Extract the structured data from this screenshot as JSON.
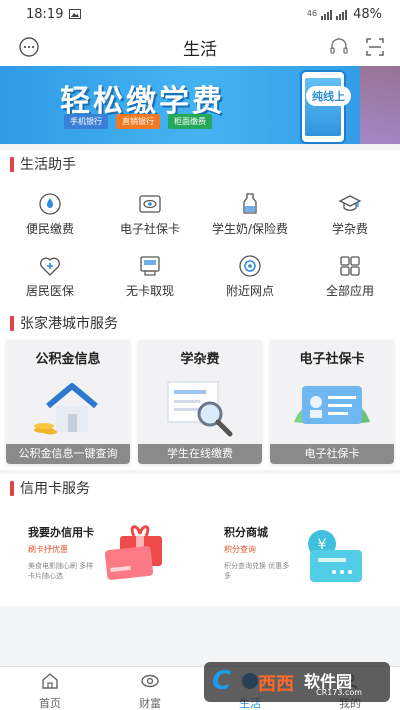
{
  "status_bar": {
    "time": "18:19",
    "signal": "46",
    "battery": "48%"
  },
  "header": {
    "title": "生活"
  },
  "banner": {
    "headline": "轻松缴学费",
    "tags": [
      "手机银行",
      "直销银行",
      "柜面缴费"
    ],
    "phone_label": "纯线上"
  },
  "life_helper": {
    "title": "生活助手",
    "items": [
      {
        "label": "便民缴费",
        "icon": "droplet-icon"
      },
      {
        "label": "电子社保卡",
        "icon": "eye-card-icon"
      },
      {
        "label": "学生奶/保险费",
        "icon": "milk-bottle-icon"
      },
      {
        "label": "学杂费",
        "icon": "graduation-cap-icon"
      },
      {
        "label": "居民医保",
        "icon": "heart-plus-icon"
      },
      {
        "label": "无卡取现",
        "icon": "atm-icon"
      },
      {
        "label": "附近网点",
        "icon": "location-pin-icon"
      },
      {
        "label": "全部应用",
        "icon": "grid-apps-icon"
      }
    ]
  },
  "city_services": {
    "title": "张家港城市服务",
    "cards": [
      {
        "title": "公积金信息",
        "caption": "公积金信息一键查询"
      },
      {
        "title": "学杂费",
        "caption": "学生在线缴费"
      },
      {
        "title": "电子社保卡",
        "caption": "电子社保卡"
      }
    ]
  },
  "credit_card": {
    "title": "信用卡服务",
    "items": [
      {
        "title": "我要办信用卡",
        "subtitle": "刷卡抒优惠",
        "desc": "美食电影随心刷 多样卡片随心选"
      },
      {
        "title": "积分商城",
        "subtitle": "积分查询",
        "desc": "积分查询兑换 优惠多多"
      }
    ]
  },
  "bottom_nav": {
    "items": [
      {
        "label": "首页",
        "icon": "home-icon"
      },
      {
        "label": "财富",
        "icon": "eye-coin-icon"
      },
      {
        "label": "生活",
        "icon": "life-icon"
      },
      {
        "label": "我的",
        "icon": "user-icon"
      }
    ],
    "active": "生活"
  },
  "watermark": {
    "main": "西西",
    "brand": "软件园",
    "url": "CR173.com"
  },
  "colors": {
    "accent": "#e0424a",
    "brand_blue": "#2d8de0",
    "banner_blue": "#3aa8ee"
  }
}
